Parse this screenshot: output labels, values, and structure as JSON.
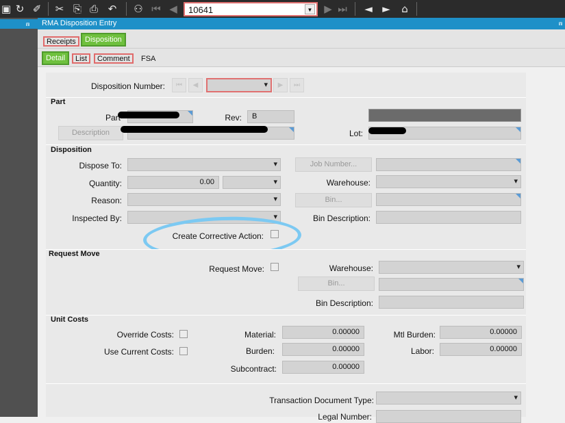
{
  "toolbar": {
    "icons": [
      "save-icon",
      "refresh-icon",
      "clear-icon",
      "cut-icon",
      "copy-icon",
      "paste-icon",
      "undo-icon",
      "binoculars-icon",
      "first-record-icon",
      "previous-record-icon",
      "next-record-icon",
      "last-record-icon",
      "back-icon",
      "forward-icon",
      "home-icon"
    ],
    "record_value": "10641"
  },
  "window": {
    "title": "RMA Disposition Entry"
  },
  "tabs": [
    "Receipts",
    "Disposition"
  ],
  "subtabs": [
    "Detail",
    "List",
    "Comment",
    "FSA"
  ],
  "header": {
    "disposition_number_label": "Disposition Number:"
  },
  "part": {
    "section": "Part",
    "part_label": "Part",
    "rev_label": "Rev:",
    "rev_value": "B",
    "description_button": "Description",
    "lot_label": "Lot:"
  },
  "disposition": {
    "section": "Disposition",
    "dispose_to_label": "Dispose To:",
    "quantity_label": "Quantity:",
    "quantity_value": "0.00",
    "reason_label": "Reason:",
    "inspected_by_label": "Inspected By:",
    "corrective_label": "Create Corrective Action:",
    "job_button": "Job Number...",
    "warehouse_label": "Warehouse:",
    "bin_button": "Bin...",
    "bin_desc_label": "Bin Description:"
  },
  "request_move": {
    "section": "Request Move",
    "request_move_label": "Request Move:",
    "warehouse_label": "Warehouse:",
    "bin_button": "Bin...",
    "bin_desc_label": "Bin Description:"
  },
  "unit_costs": {
    "section": "Unit Costs",
    "override_label": "Override Costs:",
    "use_current_label": "Use Current Costs:",
    "material_label": "Material:",
    "material_value": "0.00000",
    "burden_label": "Burden:",
    "burden_value": "0.00000",
    "subcontract_label": "Subcontract:",
    "subcontract_value": "0.00000",
    "mtl_burden_label": "Mtl Burden:",
    "mtl_burden_value": "0.00000",
    "labor_label": "Labor:",
    "labor_value": "0.00000"
  },
  "bottom": {
    "transaction_doc_label": "Transaction Document Type:",
    "legal_number_label": "Legal Number:"
  },
  "colors": {
    "accent": "#1e90c8",
    "active_tab": "#6fc03e",
    "highlight": "#e06a6a",
    "annotation": "#7cc9f2"
  }
}
